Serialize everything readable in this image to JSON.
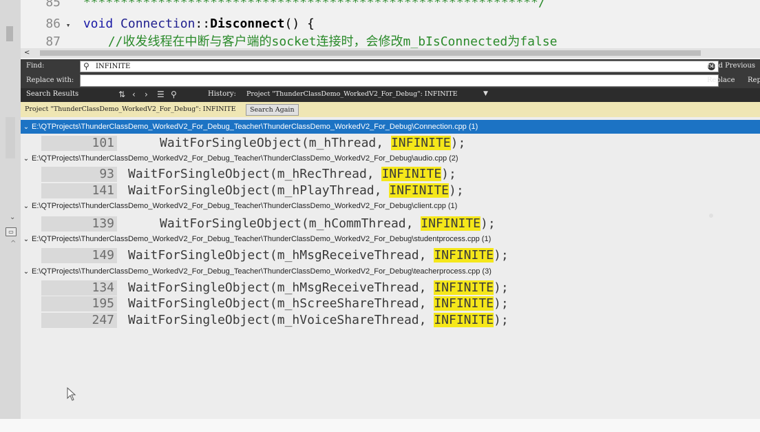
{
  "editor": {
    "lines": [
      {
        "num": "85",
        "fold": "",
        "code_stars": "*************************************************************/"
      },
      {
        "num": "86",
        "fold": "▾",
        "kw_void": "void",
        "cls": "Connection",
        "sep": "::",
        "fn": "Disconnect",
        "rest": "() {"
      },
      {
        "num": "87",
        "fold": "",
        "comment": "//收发线程在中断与客户端的socket连接时，会修改m_bIsConnected为false"
      }
    ]
  },
  "findbar": {
    "find_label": "Find:",
    "find_value": "INFINITE",
    "replace_label": "Replace with:",
    "replace_value": "",
    "find_previous": "Find Previous",
    "replace_btn": "Replace",
    "replace_all_btn": "Rep"
  },
  "results_toolbar": {
    "title": "Search Results",
    "history_label": "History:",
    "history_value": "Project \"ThunderClassDemo_WorkedV2_For_Debug\": INFINITE"
  },
  "summary": {
    "text": "Project \"ThunderClassDemo_WorkedV2_For_Debug\": INFINITE",
    "search_again": "Search Again"
  },
  "results": {
    "files": [
      {
        "path": "E:\\QTProjects\\ThunderClassDemo_WorkedV2_For_Debug_Teacher\\ThunderClassDemo_WorkedV2_For_Debug\\Connection.cpp (1)",
        "matches": [
          {
            "line": "101",
            "before": "WaitForSingleObject(m_hThread, ",
            "hit": "INFINITE",
            "after": ");"
          }
        ]
      },
      {
        "path": "E:\\QTProjects\\ThunderClassDemo_WorkedV2_For_Debug_Teacher\\ThunderClassDemo_WorkedV2_For_Debug\\audio.cpp (2)",
        "matches": [
          {
            "line": "93",
            "before": "WaitForSingleObject(m_hRecThread, ",
            "hit": "INFINITE",
            "after": ");"
          },
          {
            "line": "141",
            "before": "WaitForSingleObject(m_hPlayThread, ",
            "hit": "INFINITE",
            "after": ");"
          }
        ]
      },
      {
        "path": "E:\\QTProjects\\ThunderClassDemo_WorkedV2_For_Debug_Teacher\\ThunderClassDemo_WorkedV2_For_Debug\\client.cpp (1)",
        "matches": [
          {
            "line": "139",
            "before": "WaitForSingleObject(m_hCommThread, ",
            "hit": "INFINITE",
            "after": ");"
          }
        ]
      },
      {
        "path": "E:\\QTProjects\\ThunderClassDemo_WorkedV2_For_Debug_Teacher\\ThunderClassDemo_WorkedV2_For_Debug\\studentprocess.cpp (1)",
        "matches": [
          {
            "line": "149",
            "before": "WaitForSingleObject(m_hMsgReceiveThread, ",
            "hit": "INFINITE",
            "after": ");"
          }
        ]
      },
      {
        "path": "E:\\QTProjects\\ThunderClassDemo_WorkedV2_For_Debug_Teacher\\ThunderClassDemo_WorkedV2_For_Debug\\teacherprocess.cpp (3)",
        "matches": [
          {
            "line": "134",
            "before": "WaitForSingleObject(m_hMsgReceiveThread, ",
            "hit": "INFINITE",
            "after": ");"
          },
          {
            "line": "195",
            "before": "WaitForSingleObject(m_hScreeShareThread, ",
            "hit": "INFINITE",
            "after": ");"
          },
          {
            "line": "247",
            "before": "WaitForSingleObject(m_hVoiceShareThread, ",
            "hit": "INFINITE",
            "after": ");"
          }
        ]
      }
    ]
  },
  "colors": {
    "selected_row": "#1c73c4",
    "highlight": "#f5e71a",
    "summary_bar": "#efe6b4",
    "toolbar": "#2c2c2c"
  }
}
